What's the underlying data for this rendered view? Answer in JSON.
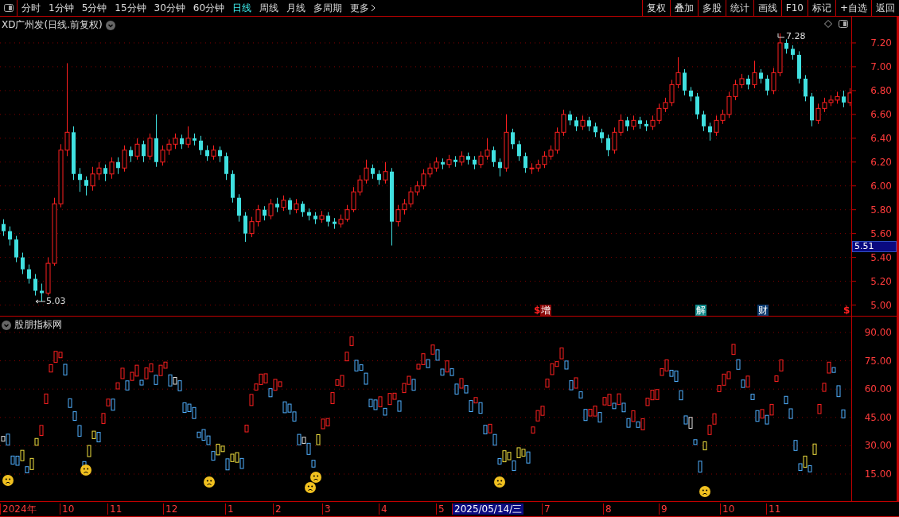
{
  "toolbar": {
    "periods": [
      {
        "label": "分时",
        "selected": false
      },
      {
        "label": "1分钟",
        "selected": false
      },
      {
        "label": "5分钟",
        "selected": false
      },
      {
        "label": "15分钟",
        "selected": false
      },
      {
        "label": "30分钟",
        "selected": false
      },
      {
        "label": "60分钟",
        "selected": false
      },
      {
        "label": "日线",
        "selected": true
      },
      {
        "label": "周线",
        "selected": false
      },
      {
        "label": "月线",
        "selected": false
      },
      {
        "label": "多周期",
        "selected": false
      }
    ],
    "more": "更多",
    "actions": [
      "复权",
      "叠加",
      "多股",
      "统计",
      "画线",
      "F10",
      "标记",
      "+自选",
      "返回"
    ]
  },
  "main_chart": {
    "title": "XD广州发(日线.前复权)",
    "high_label": "7.28",
    "low_label": "5.03",
    "current_price": "5.51",
    "events": [
      {
        "label": "$",
        "kind": "dollar"
      },
      {
        "label": "增",
        "kind": "tag",
        "color": "#8b0a0a"
      },
      {
        "label": "解",
        "kind": "tag",
        "color": "#0f8a8a"
      },
      {
        "label": "财",
        "kind": "tag",
        "color": "#0d3b70"
      },
      {
        "label": "$",
        "kind": "dollar"
      }
    ],
    "chart_data": {
      "type": "candlestick",
      "ylim": [
        4.91,
        7.42
      ],
      "grid": true,
      "yticks": [
        {
          "value": 7.2,
          "label": "7.20"
        },
        {
          "value": 7.0,
          "label": "7.00"
        },
        {
          "value": 6.8,
          "label": "6.80"
        },
        {
          "value": 6.6,
          "label": "6.60"
        },
        {
          "value": 6.4,
          "label": "6.40"
        },
        {
          "value": 6.2,
          "label": "6.20"
        },
        {
          "value": 6.0,
          "label": "6.00"
        },
        {
          "value": 5.8,
          "label": "5.80"
        },
        {
          "value": 5.6,
          "label": "5.60"
        },
        {
          "value": 5.4,
          "label": "5.40"
        },
        {
          "value": 5.2,
          "label": "5.20"
        },
        {
          "value": 5.0,
          "label": "5.00"
        }
      ],
      "ohlc": [
        [
          5.68,
          5.72,
          5.58,
          5.62
        ],
        [
          5.62,
          5.66,
          5.5,
          5.55
        ],
        [
          5.55,
          5.58,
          5.36,
          5.4
        ],
        [
          5.4,
          5.44,
          5.26,
          5.3
        ],
        [
          5.3,
          5.34,
          5.18,
          5.22
        ],
        [
          5.22,
          5.26,
          5.08,
          5.12
        ],
        [
          5.12,
          5.18,
          5.03,
          5.1
        ],
        [
          5.1,
          5.4,
          5.08,
          5.35
        ],
        [
          5.35,
          5.9,
          5.33,
          5.85
        ],
        [
          5.85,
          6.35,
          5.82,
          6.3
        ],
        [
          6.3,
          7.03,
          6.25,
          6.45
        ],
        [
          6.45,
          6.5,
          6.05,
          6.1
        ],
        [
          6.1,
          6.15,
          5.95,
          6.05
        ],
        [
          6.05,
          6.08,
          5.92,
          6.0
        ],
        [
          6.0,
          6.16,
          5.96,
          6.1
        ],
        [
          6.1,
          6.2,
          6.05,
          6.15
        ],
        [
          6.15,
          6.18,
          6.04,
          6.1
        ],
        [
          6.1,
          6.24,
          6.06,
          6.2
        ],
        [
          6.2,
          6.24,
          6.1,
          6.15
        ],
        [
          6.15,
          6.34,
          6.12,
          6.3
        ],
        [
          6.3,
          6.33,
          6.2,
          6.25
        ],
        [
          6.25,
          6.4,
          6.22,
          6.35
        ],
        [
          6.35,
          6.38,
          6.2,
          6.25
        ],
        [
          6.25,
          6.44,
          6.22,
          6.4
        ],
        [
          6.4,
          6.6,
          6.16,
          6.2
        ],
        [
          6.2,
          6.34,
          6.17,
          6.3
        ],
        [
          6.3,
          6.39,
          6.26,
          6.35
        ],
        [
          6.35,
          6.44,
          6.31,
          6.4
        ],
        [
          6.4,
          6.43,
          6.31,
          6.35
        ],
        [
          6.35,
          6.5,
          6.32,
          6.4
        ],
        [
          6.4,
          6.44,
          6.34,
          6.38
        ],
        [
          6.38,
          6.42,
          6.26,
          6.3
        ],
        [
          6.3,
          6.34,
          6.21,
          6.25
        ],
        [
          6.25,
          6.34,
          6.22,
          6.3
        ],
        [
          6.3,
          6.33,
          6.2,
          6.25
        ],
        [
          6.25,
          6.28,
          6.05,
          6.1
        ],
        [
          6.1,
          6.13,
          5.86,
          5.9
        ],
        [
          5.9,
          5.93,
          5.7,
          5.75
        ],
        [
          5.75,
          5.78,
          5.53,
          5.6
        ],
        [
          5.6,
          5.74,
          5.57,
          5.7
        ],
        [
          5.7,
          5.84,
          5.66,
          5.8
        ],
        [
          5.8,
          5.83,
          5.71,
          5.75
        ],
        [
          5.75,
          5.89,
          5.72,
          5.85
        ],
        [
          5.85,
          5.9,
          5.78,
          5.82
        ],
        [
          5.82,
          5.92,
          5.79,
          5.88
        ],
        [
          5.88,
          5.9,
          5.76,
          5.8
        ],
        [
          5.8,
          5.89,
          5.77,
          5.85
        ],
        [
          5.85,
          5.87,
          5.74,
          5.78
        ],
        [
          5.78,
          5.81,
          5.71,
          5.75
        ],
        [
          5.75,
          5.78,
          5.68,
          5.72
        ],
        [
          5.72,
          5.79,
          5.69,
          5.75
        ],
        [
          5.75,
          5.78,
          5.66,
          5.7
        ],
        [
          5.7,
          5.73,
          5.64,
          5.68
        ],
        [
          5.68,
          5.76,
          5.65,
          5.72
        ],
        [
          5.72,
          5.84,
          5.7,
          5.8
        ],
        [
          5.8,
          5.99,
          5.78,
          5.95
        ],
        [
          5.95,
          6.09,
          5.92,
          6.05
        ],
        [
          6.05,
          6.22,
          6.02,
          6.15
        ],
        [
          6.15,
          6.18,
          6.06,
          6.1
        ],
        [
          6.1,
          6.13,
          6.01,
          6.05
        ],
        [
          6.05,
          6.2,
          6.02,
          6.12
        ],
        [
          6.12,
          6.15,
          5.5,
          5.7
        ],
        [
          5.7,
          5.84,
          5.66,
          5.8
        ],
        [
          5.8,
          5.89,
          5.76,
          5.85
        ],
        [
          5.85,
          5.99,
          5.82,
          5.95
        ],
        [
          5.95,
          6.04,
          5.92,
          6.0
        ],
        [
          6.0,
          6.14,
          5.97,
          6.1
        ],
        [
          6.1,
          6.19,
          6.07,
          6.15
        ],
        [
          6.15,
          6.24,
          6.12,
          6.2
        ],
        [
          6.2,
          6.23,
          6.14,
          6.18
        ],
        [
          6.18,
          6.26,
          6.15,
          6.22
        ],
        [
          6.22,
          6.25,
          6.16,
          6.2
        ],
        [
          6.2,
          6.29,
          6.17,
          6.25
        ],
        [
          6.25,
          6.28,
          6.18,
          6.22
        ],
        [
          6.22,
          6.25,
          6.14,
          6.18
        ],
        [
          6.18,
          6.29,
          6.15,
          6.25
        ],
        [
          6.25,
          6.4,
          6.22,
          6.3
        ],
        [
          6.3,
          6.33,
          6.16,
          6.2
        ],
        [
          6.2,
          6.23,
          6.08,
          6.15
        ],
        [
          6.15,
          6.6,
          6.12,
          6.45
        ],
        [
          6.45,
          6.48,
          6.31,
          6.35
        ],
        [
          6.35,
          6.38,
          6.21,
          6.25
        ],
        [
          6.25,
          6.28,
          6.11,
          6.15
        ],
        [
          6.15,
          6.19,
          6.1,
          6.15
        ],
        [
          6.15,
          6.22,
          6.12,
          6.18
        ],
        [
          6.18,
          6.29,
          6.15,
          6.25
        ],
        [
          6.25,
          6.34,
          6.22,
          6.3
        ],
        [
          6.3,
          6.49,
          6.27,
          6.45
        ],
        [
          6.45,
          6.64,
          6.42,
          6.6
        ],
        [
          6.6,
          6.63,
          6.51,
          6.55
        ],
        [
          6.55,
          6.58,
          6.46,
          6.5
        ],
        [
          6.5,
          6.59,
          6.47,
          6.55
        ],
        [
          6.55,
          6.58,
          6.46,
          6.5
        ],
        [
          6.5,
          6.53,
          6.41,
          6.45
        ],
        [
          6.45,
          6.48,
          6.36,
          6.4
        ],
        [
          6.4,
          6.43,
          6.25,
          6.3
        ],
        [
          6.3,
          6.49,
          6.27,
          6.45
        ],
        [
          6.45,
          6.6,
          6.42,
          6.55
        ],
        [
          6.55,
          6.58,
          6.46,
          6.5
        ],
        [
          6.5,
          6.59,
          6.47,
          6.55
        ],
        [
          6.55,
          6.58,
          6.48,
          6.52
        ],
        [
          6.52,
          6.55,
          6.46,
          6.5
        ],
        [
          6.5,
          6.59,
          6.47,
          6.55
        ],
        [
          6.55,
          6.69,
          6.52,
          6.65
        ],
        [
          6.65,
          6.74,
          6.62,
          6.7
        ],
        [
          6.7,
          6.89,
          6.67,
          6.85
        ],
        [
          6.85,
          7.08,
          6.82,
          6.95
        ],
        [
          6.95,
          6.98,
          6.76,
          6.8
        ],
        [
          6.8,
          6.83,
          6.71,
          6.75
        ],
        [
          6.75,
          6.78,
          6.56,
          6.6
        ],
        [
          6.6,
          6.63,
          6.46,
          6.5
        ],
        [
          6.5,
          6.53,
          6.38,
          6.45
        ],
        [
          6.45,
          6.59,
          6.42,
          6.55
        ],
        [
          6.55,
          6.64,
          6.52,
          6.6
        ],
        [
          6.6,
          6.79,
          6.57,
          6.75
        ],
        [
          6.75,
          6.89,
          6.72,
          6.85
        ],
        [
          6.85,
          6.94,
          6.82,
          6.9
        ],
        [
          6.9,
          6.93,
          6.81,
          6.85
        ],
        [
          6.85,
          7.05,
          6.82,
          6.95
        ],
        [
          6.95,
          6.98,
          6.86,
          6.9
        ],
        [
          6.9,
          6.93,
          6.76,
          6.8
        ],
        [
          6.8,
          6.99,
          6.77,
          6.95
        ],
        [
          6.95,
          7.28,
          6.92,
          7.2
        ],
        [
          7.2,
          7.23,
          7.11,
          7.15
        ],
        [
          7.15,
          7.18,
          7.06,
          7.1
        ],
        [
          7.1,
          7.13,
          6.86,
          6.9
        ],
        [
          6.9,
          6.93,
          6.71,
          6.75
        ],
        [
          6.75,
          6.78,
          6.5,
          6.55
        ],
        [
          6.55,
          6.69,
          6.52,
          6.65
        ],
        [
          6.65,
          6.74,
          6.62,
          6.7
        ],
        [
          6.7,
          6.76,
          6.67,
          6.72
        ],
        [
          6.72,
          6.79,
          6.69,
          6.75
        ],
        [
          6.75,
          6.8,
          6.66,
          6.7
        ],
        [
          6.7,
          6.82,
          6.67,
          6.78
        ]
      ]
    }
  },
  "indicator": {
    "title": "股朋指标网",
    "ticks": [
      "90.00",
      "75.00",
      "60.00",
      "45.00",
      "30.00",
      "15.00"
    ]
  },
  "time_axis": [
    {
      "label": "2024年",
      "kind": "month"
    },
    {
      "label": "10",
      "kind": "month"
    },
    {
      "label": "11",
      "kind": "month"
    },
    {
      "label": "12",
      "kind": "month"
    },
    {
      "label": "1",
      "kind": "month"
    },
    {
      "label": "2",
      "kind": "month"
    },
    {
      "label": "3",
      "kind": "month"
    },
    {
      "label": "4",
      "kind": "month"
    },
    {
      "label": "5",
      "kind": "month"
    },
    {
      "label": "2025/05/14/三",
      "kind": "cursor"
    },
    {
      "label": "7",
      "kind": "month"
    },
    {
      "label": "8",
      "kind": "month"
    },
    {
      "label": "9",
      "kind": "month"
    },
    {
      "label": "10",
      "kind": "month"
    },
    {
      "label": "11",
      "kind": "month"
    }
  ]
}
